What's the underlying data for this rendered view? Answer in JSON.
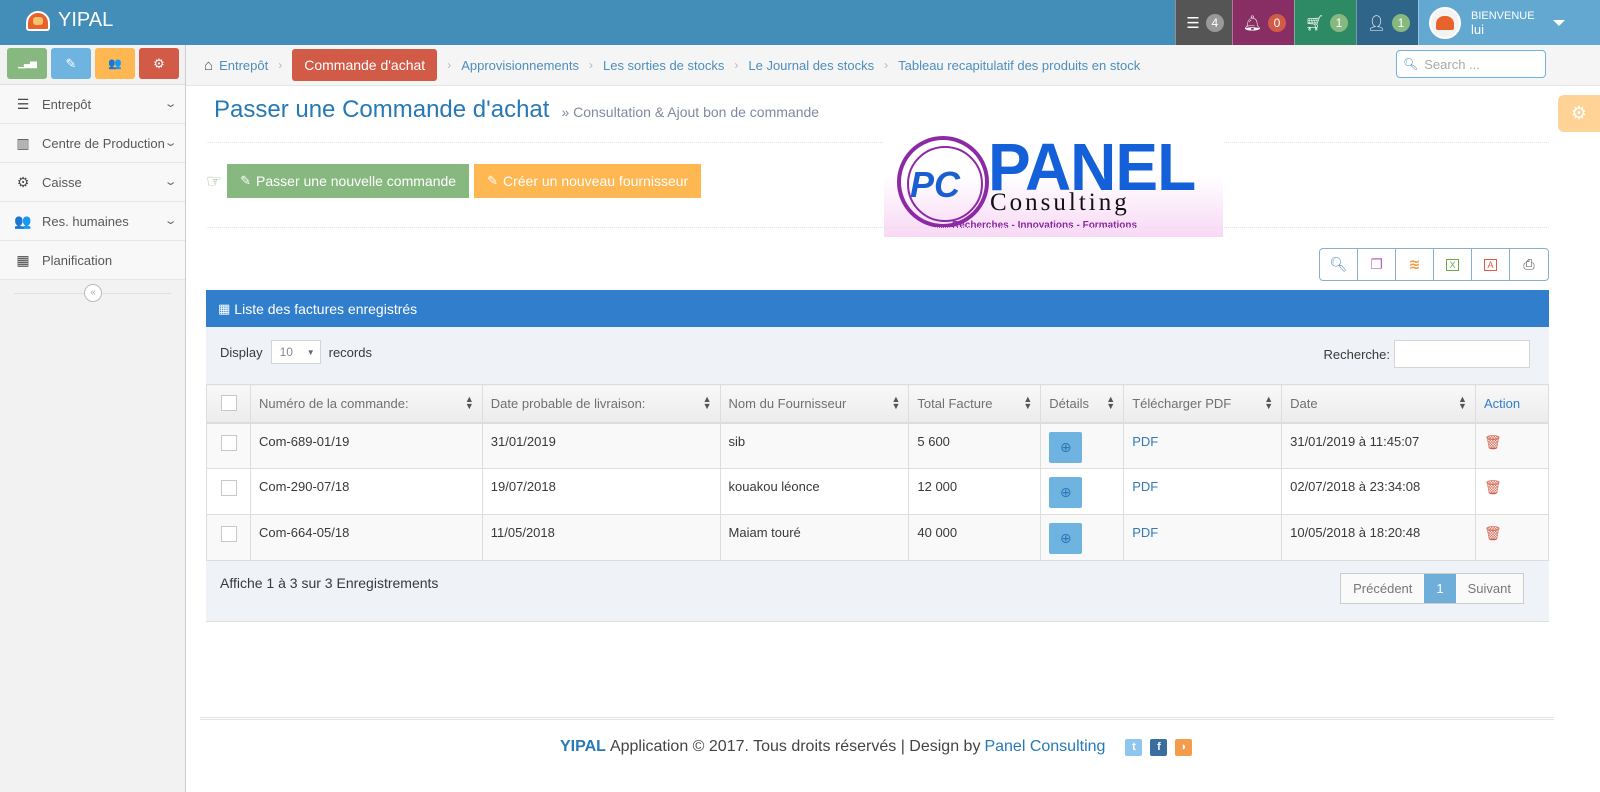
{
  "app": {
    "name": "YIPAL"
  },
  "navbar": {
    "tasks_count": "4",
    "notifications_count": "0",
    "cart_count": "1",
    "users_count": "1",
    "welcome_label": "BIENVENUE",
    "username": "lui"
  },
  "sidebar": {
    "shortcuts": [
      {
        "icon": "signal-icon",
        "glyph": "▁▃▅",
        "color": "#87b87f"
      },
      {
        "icon": "pencil-icon",
        "glyph": "✎",
        "color": "#6fb3e0"
      },
      {
        "icon": "users-icon",
        "glyph": "👥",
        "color": "#ffb752"
      },
      {
        "icon": "cogs-icon",
        "glyph": "⚙",
        "color": "#d15b47"
      }
    ],
    "items": [
      {
        "label": "Entrepôt",
        "icon": "list-icon",
        "glyph": "☰",
        "has_submenu": true
      },
      {
        "label": "Centre de Production",
        "icon": "barcode-icon",
        "glyph": "▥",
        "has_submenu": true
      },
      {
        "label": "Caisse",
        "icon": "cogs-icon",
        "glyph": "⚙",
        "has_submenu": true
      },
      {
        "label": "Res. humaines",
        "icon": "users-icon",
        "glyph": "👥",
        "has_submenu": true
      },
      {
        "label": "Planification",
        "icon": "calendar-icon",
        "glyph": "▦",
        "has_submenu": false
      }
    ],
    "collapse_glyph": "«"
  },
  "breadcrumbs": {
    "home": "Entrepôt",
    "active": "Commande d'achat",
    "items": [
      "Approvisionnements",
      "Les sorties de stocks",
      "Le Journal des stocks",
      "Tableau recapitulatif des produits en stock"
    ],
    "search_placeholder": "Search ..."
  },
  "page": {
    "title": "Passer une Commande d'achat",
    "subtitle": "» Consultation & Ajout bon de commande",
    "btn_new_order": "Passer une nouvelle commande",
    "btn_new_supplier": "Créer un nouveau fournisseur"
  },
  "logo": {
    "initials": "PC",
    "name": "PANEL",
    "sub": "Consulting",
    "tagline": "Recherches  -  Innovations  -  Formations"
  },
  "tools": [
    {
      "name": "search-tool",
      "glyph": "🔍",
      "color": "#4c8fbd"
    },
    {
      "name": "copy-tool",
      "glyph": "❐",
      "color": "#c05dbb"
    },
    {
      "name": "database-tool",
      "glyph": "≋",
      "color": "#f59942"
    },
    {
      "name": "excel-tool",
      "glyph": "X",
      "color": "#69aa46"
    },
    {
      "name": "pdf-tool",
      "glyph": "⎙",
      "color": "#dd5a43"
    },
    {
      "name": "print-tool",
      "glyph": "⎙",
      "color": "#555"
    }
  ],
  "table_panel": {
    "title": "Liste des factures enregistrés",
    "display_label": "Display",
    "page_size": "10",
    "records_label": "records",
    "search_label": "Recherche:",
    "columns": [
      "Numéro de la commande:",
      "Date probable de livraison:",
      "Nom du Fournisseur",
      "Total Facture",
      "Détails",
      "Télécharger PDF",
      "Date",
      "Action"
    ],
    "rows": [
      {
        "numero": "Com-689-01/19",
        "date_livraison": "31/01/2019",
        "fournisseur": "sib",
        "total": "5 600",
        "pdf": "PDF",
        "date": "31/01/2019 à 11:45:07"
      },
      {
        "numero": "Com-290-07/18",
        "date_livraison": "19/07/2018",
        "fournisseur": "kouakou léonce",
        "total": "12 000",
        "pdf": "PDF",
        "date": "02/07/2018 à 23:34:08"
      },
      {
        "numero": "Com-664-05/18",
        "date_livraison": "11/05/2018",
        "fournisseur": "Maiam touré",
        "total": "40 000",
        "pdf": "PDF",
        "date": "10/05/2018 à 18:20:48"
      }
    ],
    "info": "Affiche 1 à 3 sur 3 Enregistrements",
    "pagination": {
      "previous": "Précédent",
      "current": "1",
      "next": "Suivant"
    }
  },
  "footer": {
    "brand": "YIPAL",
    "text": "Application © 2017. Tous droits réservés | Design by",
    "designer": "Panel Consulting"
  }
}
